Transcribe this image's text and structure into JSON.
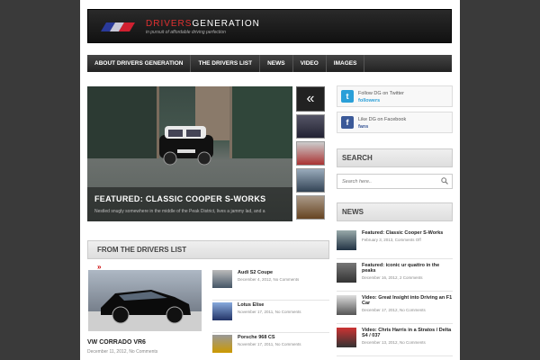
{
  "header": {
    "logo_part1": "DRIVERS",
    "logo_part2": "GENERATION",
    "tagline": "in pursuit of affordable driving perfection"
  },
  "nav": [
    "About Drivers Generation",
    "The Drivers List",
    "News",
    "Video",
    "Images"
  ],
  "slider": {
    "title": "Featured: Classic Cooper S-Works",
    "caption": "Nestled snugly somewhere in the middle of the Peak District, lives a jammy lad, and a",
    "prev_glyph": "«"
  },
  "drivers_list": {
    "heading": "From the Drivers List",
    "arrow": "»",
    "featured": {
      "title": "VW Corrado VR6",
      "meta": "December 11, 2012, No Comments"
    },
    "items": [
      {
        "title": "Audi S2 Coupe",
        "meta": "December 4, 2012, No Comments"
      },
      {
        "title": "Lotus Elise",
        "meta": "November 17, 2011, No Comments"
      },
      {
        "title": "Porsche 968 CS",
        "meta": "November 17, 2011, No Comments"
      }
    ]
  },
  "social": {
    "twitter": {
      "label": "Follow DG on Twitter",
      "sub": "followers"
    },
    "facebook": {
      "label": "Like DG on Facebook",
      "sub": "fans"
    }
  },
  "search": {
    "heading": "Search",
    "placeholder": "Search here.."
  },
  "news": {
    "heading": "News",
    "items": [
      {
        "title": "Featured: Classic Cooper S-Works",
        "meta": "February 3, 2013, Comments Off"
      },
      {
        "title": "Featured: iconic ur quattro in the peaks",
        "meta": "December 16, 2012, 2 Comments"
      },
      {
        "title": "Video: Great Insight into Driving an F1 Car",
        "meta": "December 17, 2012, No Comments"
      },
      {
        "title": "Video: Chris Harris in a Stratos / Delta S4 / 037",
        "meta": "December 13, 2012, No Comments"
      }
    ]
  },
  "colors": {
    "accent": "#cc0000",
    "twitter": "#2a9fd8",
    "facebook": "#3b5998"
  }
}
